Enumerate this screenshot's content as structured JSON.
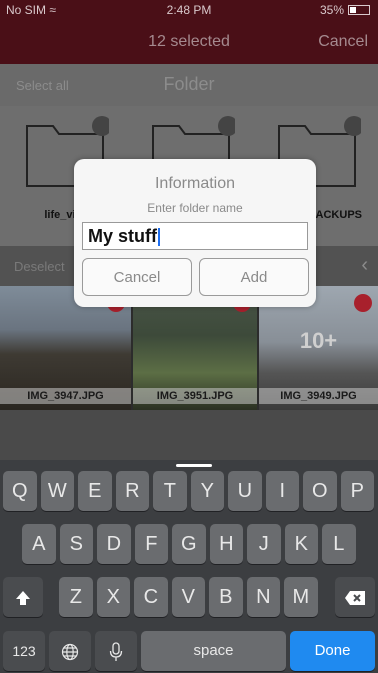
{
  "status": {
    "carrier": "No SIM",
    "time": "2:48 PM",
    "battery": "35%",
    "battery_level": 0.35
  },
  "nav": {
    "title": "12 selected",
    "cancel_label": "Cancel"
  },
  "toolbar": {
    "select_all": "Select all",
    "title": "Folder"
  },
  "folders": [
    {
      "label": "life_vic",
      "icon": "folder-icon",
      "selected": true
    },
    {
      "label": "",
      "icon": "folder-icon",
      "selected": true
    },
    {
      "label": "ACKUPS",
      "icon": "folder-icon",
      "selected": true
    }
  ],
  "section2": {
    "deselect": "Deselect",
    "back_icon": "chevron-left-icon"
  },
  "photos": [
    {
      "label": "IMG_3947.JPG"
    },
    {
      "label": "IMG_3951.JPG"
    },
    {
      "label": "IMG_3949.JPG",
      "overlay": "10+"
    }
  ],
  "dialog": {
    "title": "Information",
    "message": "Enter folder name",
    "input_value": "My stuff",
    "cancel_label": "Cancel",
    "add_label": "Add"
  },
  "keyboard": {
    "row1": [
      "Q",
      "W",
      "E",
      "R",
      "T",
      "Y",
      "U",
      "I",
      "O",
      "P"
    ],
    "row2": [
      "A",
      "S",
      "D",
      "F",
      "G",
      "H",
      "J",
      "K",
      "L"
    ],
    "row3": [
      "Z",
      "X",
      "C",
      "V",
      "B",
      "N",
      "M"
    ],
    "numbers_label": "123",
    "space_label": "space",
    "done_label": "Done",
    "shift_icon": "shift-icon",
    "globe_icon": "globe-icon",
    "mic_icon": "microphone-icon",
    "delete_icon": "backspace-icon"
  },
  "colors": {
    "accent_red": "#a8202c",
    "nav_bg": "#4a0f17",
    "done_blue": "#1f8af0"
  }
}
